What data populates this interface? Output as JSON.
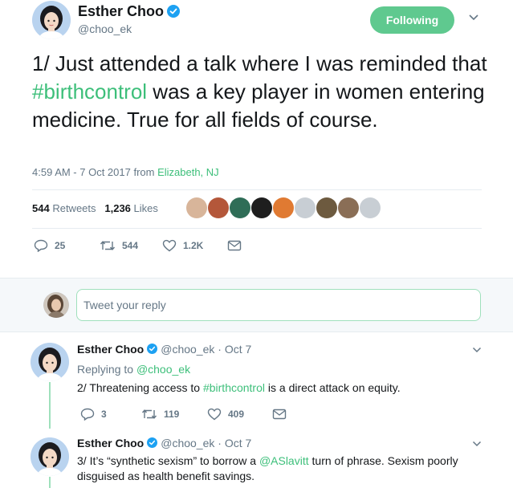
{
  "main_tweet": {
    "author_name": "Esther Choo",
    "author_handle": "@choo_ek",
    "follow_label": "Following",
    "text_part1": "1/ Just attended a talk where I was reminded that ",
    "text_hashtag": "#birthcontrol",
    "text_part2": " was a key player in women entering medicine. True for all fields of course.",
    "timestamp": "4:59 AM - 7 Oct 2017 from ",
    "location": "Elizabeth, NJ",
    "retweets_count": "544",
    "retweets_label": "Retweets",
    "likes_count": "1,236",
    "likes_label": "Likes",
    "actions": {
      "reply_count": "25",
      "retweet_count": "544",
      "like_count": "1.2K"
    }
  },
  "reply_box": {
    "placeholder": "Tweet your reply"
  },
  "replies": [
    {
      "author_name": "Esther Choo",
      "author_handle": "@choo_ek",
      "date": "Oct 7",
      "replying_prefix": "Replying to ",
      "replying_handle": "@choo_ek",
      "text_part1": "2/ Threatening access to ",
      "text_hashtag": "#birthcontrol",
      "text_part2": " is a direct attack on equity.",
      "reply_count": "3",
      "retweet_count": "119",
      "like_count": "409"
    },
    {
      "author_name": "Esther Choo",
      "author_handle": "@choo_ek",
      "date": "Oct 7",
      "text_part1": "3/ It’s “synthetic sexism” to borrow a ",
      "text_mention": "@ASlavitt",
      "text_part2": " turn of phrase. Sexism poorly disguised as health benefit savings."
    }
  ],
  "colors": {
    "accent_green": "#3dbf7a",
    "following_button": "#5fc98f",
    "verified_blue": "#1da1f2",
    "muted_text": "#657786"
  },
  "icons": [
    "verified-badge-icon",
    "chevron-down-icon",
    "reply-icon",
    "retweet-icon",
    "heart-icon",
    "direct-message-icon"
  ]
}
